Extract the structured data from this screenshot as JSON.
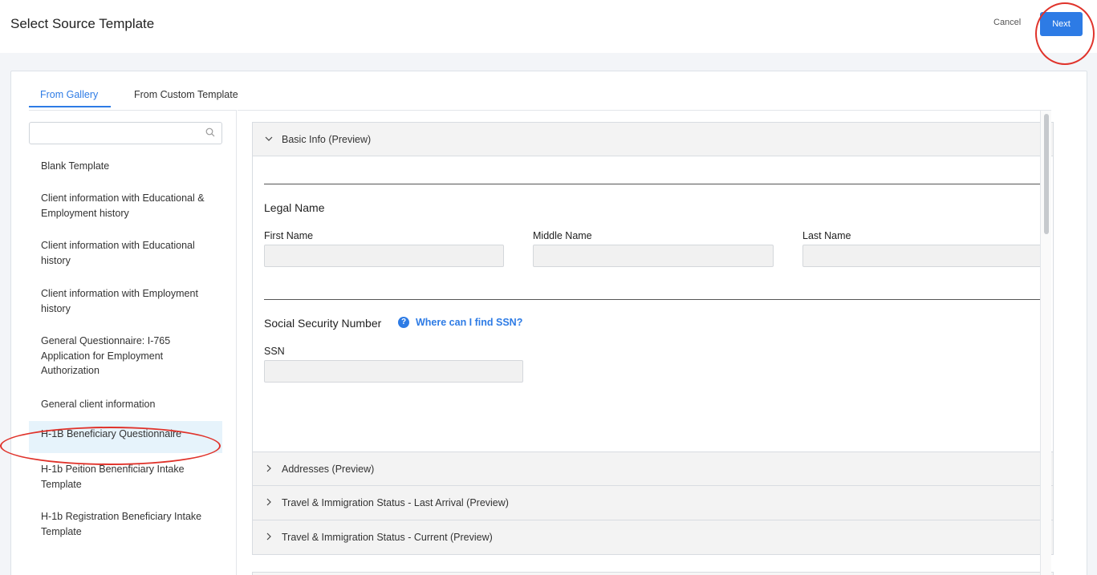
{
  "header": {
    "title": "Select Source Template",
    "cancel_label": "Cancel",
    "next_label": "Next"
  },
  "tabs": [
    {
      "label": "From Gallery",
      "active": true
    },
    {
      "label": "From Custom Template",
      "active": false
    }
  ],
  "search": {
    "placeholder": "",
    "value": ""
  },
  "templates": [
    {
      "label": "Blank Template"
    },
    {
      "label": "Client information with Educational & Employment history"
    },
    {
      "label": "Client information with Educational history"
    },
    {
      "label": "Client information with Employment history"
    },
    {
      "label": "General Questionnaire: I-765 Application for Employment Authorization"
    },
    {
      "label": "General client information"
    },
    {
      "label": "H-1B Beneficiary Questionnaire",
      "selected": true
    },
    {
      "label": "H-1b Peition Benenficiary Intake Template"
    },
    {
      "label": "H-1b Registration Beneficiary Intake Template"
    }
  ],
  "preview": {
    "basic_info": {
      "title": "Basic Info (Preview)",
      "legal_name_heading": "Legal Name",
      "first_name_label": "First Name",
      "middle_name_label": "Middle Name",
      "last_name_label": "Last Name",
      "ssn_heading": "Social Security Number",
      "ssn_help_icon": "?",
      "ssn_help_link": "Where can I find SSN?",
      "ssn_label": "SSN"
    },
    "collapsed_sections": [
      {
        "title": "Addresses (Preview)"
      },
      {
        "title": "Travel & Immigration Status - Last Arrival (Preview)"
      },
      {
        "title": "Travel & Immigration Status - Current (Preview)"
      }
    ]
  },
  "colors": {
    "accent": "#2d7be5",
    "annotation": "#e0332b",
    "selected_bg": "#e6f3fb"
  },
  "icons": {
    "search": "search-icon",
    "expanded": "chevron-down-icon",
    "collapsed": "chevron-right-icon",
    "help": "help-icon"
  }
}
